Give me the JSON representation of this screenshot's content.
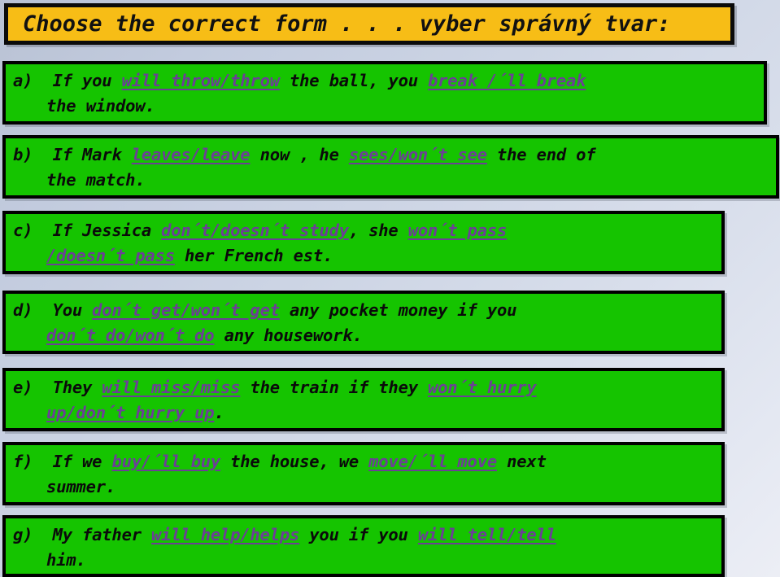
{
  "slide": {
    "title": "Choose the correct form . . . vyber správný tvar:",
    "background_color": "#c6cfe0",
    "title_background_color": "#f7bd16",
    "item_background_color": "#15c400",
    "highlight_color": "#6c3f96",
    "text_color": "#0a0a0a"
  },
  "items": [
    {
      "label": "a)",
      "line1": [
        {
          "text": "If you ",
          "style": "plain"
        },
        {
          "text": "will throw/throw",
          "style": "highlight"
        },
        {
          "text": " the ball, you ",
          "style": "plain"
        },
        {
          "text": "break /´ll break",
          "style": "highlight"
        }
      ],
      "line2": [
        {
          "text": "the window.",
          "style": "plain"
        }
      ]
    },
    {
      "label": "b)",
      "line1": [
        {
          "text": "If Mark ",
          "style": "plain"
        },
        {
          "text": "leaves/leave",
          "style": "highlight"
        },
        {
          "text": " now , he ",
          "style": "plain"
        },
        {
          "text": "sees/won´t see",
          "style": "highlight"
        },
        {
          "text": " the end of",
          "style": "plain"
        }
      ],
      "line2": [
        {
          "text": "the match.",
          "style": "plain"
        }
      ]
    },
    {
      "label": "c)",
      "line1": [
        {
          "text": "If Jessica ",
          "style": "plain"
        },
        {
          "text": "don´t/doesn´t study",
          "style": "highlight"
        },
        {
          "text": ", she ",
          "style": "plain"
        },
        {
          "text": "won´t pass",
          "style": "highlight"
        }
      ],
      "line2": [
        {
          "text": "/doesn´t pass",
          "style": "highlight"
        },
        {
          "text": " her French est.",
          "style": "plain"
        }
      ]
    },
    {
      "label": "d)",
      "line1": [
        {
          "text": "You ",
          "style": "plain"
        },
        {
          "text": "don´t get/won´t get",
          "style": "highlight"
        },
        {
          "text": " any pocket money if you",
          "style": "plain"
        }
      ],
      "line2": [
        {
          "text": "don´t do/won´t do",
          "style": "highlight"
        },
        {
          "text": " any housework.",
          "style": "plain"
        }
      ]
    },
    {
      "label": "e)",
      "line1": [
        {
          "text": "They ",
          "style": "plain"
        },
        {
          "text": "will miss/miss",
          "style": "highlight"
        },
        {
          "text": " the train if they ",
          "style": "plain"
        },
        {
          "text": "won´t hurry",
          "style": "highlight"
        }
      ],
      "line2": [
        {
          "text": "up/don´t hurry up",
          "style": "highlight"
        },
        {
          "text": ".",
          "style": "plain"
        }
      ]
    },
    {
      "label": "f)",
      "line1": [
        {
          "text": "If we ",
          "style": "plain"
        },
        {
          "text": "buy/´ll buy",
          "style": "highlight"
        },
        {
          "text": " the house, we ",
          "style": "plain"
        },
        {
          "text": "move/´ll move",
          "style": "highlight"
        },
        {
          "text": " next",
          "style": "plain"
        }
      ],
      "line2": [
        {
          "text": "summer.",
          "style": "plain"
        }
      ]
    },
    {
      "label": "g)",
      "line1": [
        {
          "text": "My father ",
          "style": "plain"
        },
        {
          "text": "will help/helps",
          "style": "highlight"
        },
        {
          "text": " you if you ",
          "style": "plain"
        },
        {
          "text": "will tell/tell",
          "style": "highlight"
        }
      ],
      "line2": [
        {
          "text": "him.",
          "style": "plain"
        }
      ]
    }
  ]
}
